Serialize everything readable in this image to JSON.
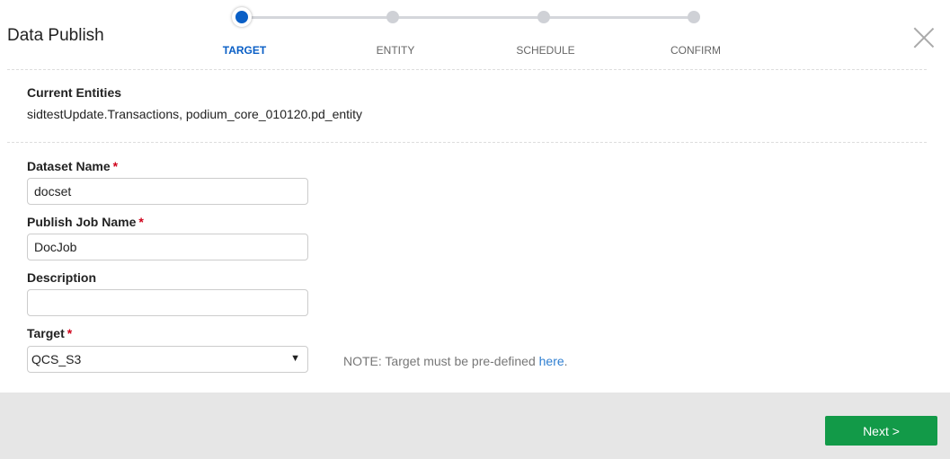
{
  "header": {
    "title": "Data Publish"
  },
  "steps": [
    {
      "label": "TARGET"
    },
    {
      "label": "ENTITY"
    },
    {
      "label": "SCHEDULE"
    },
    {
      "label": "CONFIRM"
    }
  ],
  "current_entities": {
    "label": "Current Entities",
    "value": "sidtestUpdate.Transactions, podium_core_010120.pd_entity"
  },
  "form": {
    "dataset_name": {
      "label": "Dataset Name",
      "value": "docset"
    },
    "job_name": {
      "label": "Publish Job Name",
      "value": "DocJob"
    },
    "description": {
      "label": "Description",
      "value": ""
    },
    "target": {
      "label": "Target",
      "value": "QCS_S3"
    },
    "required_mark": "*",
    "note": "NOTE: Target must be pre-defined ",
    "note_link": "here",
    "note_end": "."
  },
  "footer": {
    "next_label": "Next >"
  },
  "colors": {
    "accent": "#0a5fc6",
    "next": "#129a48"
  }
}
